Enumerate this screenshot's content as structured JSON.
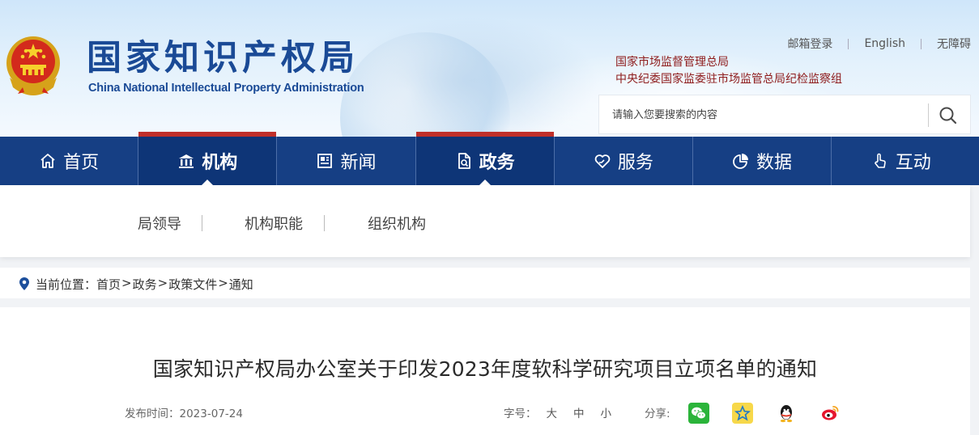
{
  "header": {
    "title": "国家知识产权局",
    "subtitle": "China National Intellectual Property Administration",
    "top_links": [
      "邮箱登录",
      "English",
      "无障碍"
    ],
    "related_links": [
      "国家市场监督管理总局",
      "中央纪委国家监委驻市场监管总局纪检监察组"
    ],
    "search": {
      "placeholder": "请输入您要搜索的内容",
      "icon": "search-icon"
    }
  },
  "nav": {
    "items": [
      {
        "label": "首页",
        "icon": "home-icon",
        "active": false
      },
      {
        "label": "机构",
        "icon": "institution-icon",
        "active": true
      },
      {
        "label": "新闻",
        "icon": "news-icon",
        "active": false
      },
      {
        "label": "政务",
        "icon": "document-icon",
        "active": true
      },
      {
        "label": "服务",
        "icon": "heart-hand-icon",
        "active": false
      },
      {
        "label": "数据",
        "icon": "pie-chart-icon",
        "active": false
      },
      {
        "label": "互动",
        "icon": "hand-pointer-icon",
        "active": false
      }
    ],
    "accent_color": "#c0302a",
    "bar_color": "#163f84"
  },
  "subnav": {
    "items": [
      "局领导",
      "机构职能",
      "组织机构"
    ]
  },
  "breadcrumb": {
    "prefix": "当前位置：",
    "items": [
      "首页",
      "政务",
      "政策文件",
      "通知"
    ],
    "separator": ">"
  },
  "article": {
    "title": "国家知识产权局办公室关于印发2023年度软科学研究项目立项名单的通知",
    "date_label": "发布时间：2023-07-24",
    "font_label": "字号：",
    "font_sizes": [
      "大",
      "中",
      "小"
    ],
    "share_label": "分享:",
    "share_icons": [
      "wechat-icon",
      "qzone-icon",
      "qq-icon",
      "weibo-icon"
    ]
  }
}
